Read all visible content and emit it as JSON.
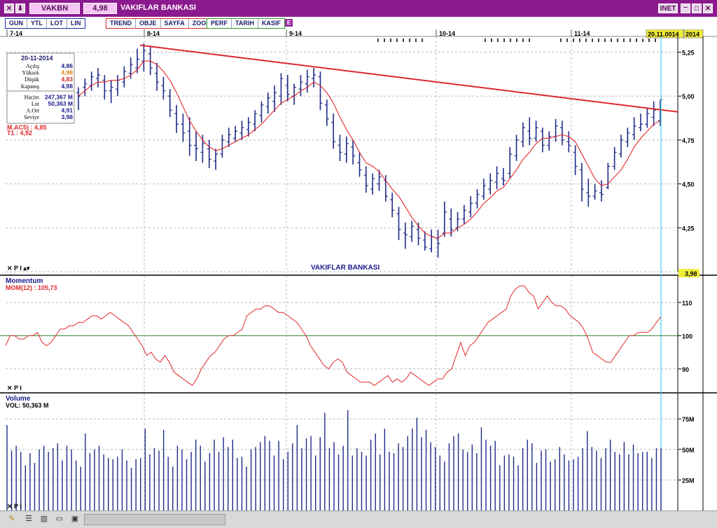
{
  "window": {
    "symbol": "VAKBN",
    "price": "4,98",
    "title": "VAKIFLAR BANKASI",
    "inet_label": "INET",
    "close_glyph": "✕",
    "down_glyph": "⬇",
    "min_glyph": "–",
    "max_glyph": "□",
    "x_glyph": "✕"
  },
  "toolbar": {
    "blue_group": [
      "GUN",
      "YTL",
      "LOT",
      "LIN"
    ],
    "red_group": [
      "TREND",
      "OBJE",
      "SAYFA",
      "ZOOM"
    ],
    "green_group": [
      "PERF",
      "TARIH",
      "KASIF"
    ],
    "e_label": "E"
  },
  "colors": {
    "title_bg": "#8b1a8f",
    "bar": "#1f2a8a",
    "ma": "#e0282a",
    "trend": "#e0282a",
    "momentum": "#e0282a",
    "baseline": "#2a8a2a",
    "volume": "#1f2a8a",
    "cursor": "#3fcfe8",
    "highlight": "#f0ee3a"
  },
  "chart_data": [
    {
      "type": "ohlc",
      "title": "VAKIFLAR BANKASI",
      "date_axis_labels": [
        "7-14",
        "8-14",
        "9-14",
        "10-14",
        "11-14"
      ],
      "cursor_date": "20.11.0014",
      "year_label": "2014",
      "y_ticks": [
        "5,25",
        "5,00",
        "4,75",
        "4,50",
        "4,25",
        "4,00"
      ],
      "ylim": [
        4.0,
        5.3
      ],
      "current_value_label": "3,98",
      "info_box": {
        "date": "20-11-2014",
        "rows": [
          {
            "label": "Açılış",
            "value": "4,86"
          },
          {
            "label": "Yüksek",
            "value": "4,98"
          },
          {
            "label": "Düşük",
            "value": "4,83"
          },
          {
            "label": "Kapanış",
            "value": "4,98"
          },
          {
            "label": "Hacim",
            "value": "247,367 M"
          },
          {
            "label": "Lot",
            "value": "50,363 M"
          },
          {
            "label": "A.Ort",
            "value": "4,91"
          },
          {
            "label": "Seviye",
            "value": "3,98"
          }
        ]
      },
      "legend": [
        {
          "label": "M.AC5)",
          "value": "4,85"
        },
        {
          "label": "T1",
          "value": "4,92"
        }
      ],
      "trendline": [
        [
          5.29,
          0.2
        ],
        [
          4.91,
          1.0
        ]
      ],
      "ohlc": [
        [
          5.02,
          5.05,
          4.92,
          5.0
        ],
        [
          5.05,
          5.1,
          5.0,
          5.07
        ],
        [
          5.06,
          5.14,
          5.03,
          5.11
        ],
        [
          5.1,
          5.16,
          5.05,
          5.12
        ],
        [
          5.09,
          5.12,
          4.98,
          5.03
        ],
        [
          5.03,
          5.09,
          4.96,
          5.05
        ],
        [
          5.04,
          5.12,
          5.0,
          5.09
        ],
        [
          5.08,
          5.17,
          5.05,
          5.14
        ],
        [
          5.13,
          5.22,
          5.1,
          5.18
        ],
        [
          5.16,
          5.27,
          5.13,
          5.21
        ],
        [
          5.2,
          5.3,
          5.14,
          5.26
        ],
        [
          5.24,
          5.28,
          5.12,
          5.16
        ],
        [
          5.13,
          5.19,
          5.03,
          5.08
        ],
        [
          5.06,
          5.11,
          4.98,
          5.03
        ],
        [
          5.0,
          5.04,
          4.88,
          4.92
        ],
        [
          4.9,
          4.95,
          4.79,
          4.84
        ],
        [
          4.84,
          4.9,
          4.74,
          4.79
        ],
        [
          4.8,
          4.88,
          4.66,
          4.72
        ],
        [
          4.72,
          4.8,
          4.63,
          4.7
        ],
        [
          4.68,
          4.78,
          4.62,
          4.73
        ],
        [
          4.7,
          4.75,
          4.59,
          4.64
        ],
        [
          4.63,
          4.7,
          4.58,
          4.67
        ],
        [
          4.67,
          4.78,
          4.65,
          4.75
        ],
        [
          4.74,
          4.82,
          4.71,
          4.78
        ],
        [
          4.76,
          4.83,
          4.74,
          4.8
        ],
        [
          4.79,
          4.86,
          4.75,
          4.82
        ],
        [
          4.81,
          4.88,
          4.77,
          4.85
        ],
        [
          4.84,
          4.92,
          4.8,
          4.9
        ],
        [
          4.89,
          4.97,
          4.85,
          4.95
        ],
        [
          4.94,
          5.02,
          4.9,
          4.99
        ],
        [
          4.97,
          5.06,
          4.91,
          5.02
        ],
        [
          5.0,
          5.13,
          4.95,
          5.1
        ],
        [
          5.06,
          5.12,
          4.97,
          5.01
        ],
        [
          5.0,
          5.07,
          4.95,
          5.05
        ],
        [
          5.04,
          5.12,
          5.0,
          5.08
        ],
        [
          5.07,
          5.15,
          5.02,
          5.11
        ],
        [
          5.1,
          5.16,
          5.05,
          5.12
        ],
        [
          5.11,
          5.14,
          4.92,
          4.96
        ],
        [
          4.95,
          4.98,
          4.83,
          4.87
        ],
        [
          4.85,
          4.9,
          4.7,
          4.74
        ],
        [
          4.72,
          4.78,
          4.63,
          4.68
        ],
        [
          4.67,
          4.77,
          4.62,
          4.73
        ],
        [
          4.71,
          4.75,
          4.61,
          4.66
        ],
        [
          4.62,
          4.68,
          4.54,
          4.58
        ],
        [
          4.55,
          4.6,
          4.45,
          4.49
        ],
        [
          4.47,
          4.56,
          4.44,
          4.53
        ],
        [
          4.5,
          4.58,
          4.46,
          4.54
        ],
        [
          4.52,
          4.55,
          4.4,
          4.43
        ],
        [
          4.41,
          4.45,
          4.31,
          4.35
        ],
        [
          4.33,
          4.37,
          4.18,
          4.24
        ],
        [
          4.22,
          4.28,
          4.13,
          4.21
        ],
        [
          4.2,
          4.29,
          4.17,
          4.26
        ],
        [
          4.24,
          4.28,
          4.15,
          4.19
        ],
        [
          4.18,
          4.23,
          4.12,
          4.14
        ],
        [
          4.13,
          4.24,
          4.11,
          4.2
        ],
        [
          4.19,
          4.24,
          4.08,
          4.16
        ],
        [
          4.22,
          4.4,
          4.2,
          4.34
        ],
        [
          4.3,
          4.36,
          4.2,
          4.24
        ],
        [
          4.25,
          4.34,
          4.23,
          4.3
        ],
        [
          4.3,
          4.38,
          4.27,
          4.35
        ],
        [
          4.34,
          4.43,
          4.31,
          4.39
        ],
        [
          4.39,
          4.47,
          4.36,
          4.44
        ],
        [
          4.43,
          4.53,
          4.41,
          4.49
        ],
        [
          4.47,
          4.56,
          4.44,
          4.52
        ],
        [
          4.51,
          4.6,
          4.47,
          4.56
        ],
        [
          4.53,
          4.59,
          4.49,
          4.52
        ],
        [
          4.56,
          4.71,
          4.53,
          4.67
        ],
        [
          4.66,
          4.78,
          4.63,
          4.75
        ],
        [
          4.74,
          4.85,
          4.71,
          4.82
        ],
        [
          4.8,
          4.88,
          4.72,
          4.76
        ],
        [
          4.76,
          4.86,
          4.74,
          4.82
        ],
        [
          4.8,
          4.82,
          4.68,
          4.72
        ],
        [
          4.72,
          4.8,
          4.69,
          4.77
        ],
        [
          4.77,
          4.87,
          4.74,
          4.83
        ],
        [
          4.82,
          4.86,
          4.72,
          4.75
        ],
        [
          4.74,
          4.8,
          4.68,
          4.72
        ],
        [
          4.68,
          4.72,
          4.55,
          4.6
        ],
        [
          4.58,
          4.62,
          4.4,
          4.47
        ],
        [
          4.45,
          4.53,
          4.37,
          4.43
        ],
        [
          4.43,
          4.5,
          4.41,
          4.46
        ],
        [
          4.45,
          4.52,
          4.4,
          4.44
        ],
        [
          4.48,
          4.62,
          4.47,
          4.6
        ],
        [
          4.6,
          4.71,
          4.58,
          4.68
        ],
        [
          4.67,
          4.78,
          4.65,
          4.75
        ],
        [
          4.74,
          4.82,
          4.71,
          4.79
        ],
        [
          4.78,
          4.88,
          4.75,
          4.83
        ],
        [
          4.82,
          4.9,
          4.8,
          4.84
        ],
        [
          4.84,
          4.93,
          4.82,
          4.9
        ],
        [
          4.88,
          4.97,
          4.83,
          4.92
        ],
        [
          4.86,
          4.98,
          4.83,
          4.98
        ]
      ],
      "moving_average": [
        5.0,
        5.03,
        5.06,
        5.08,
        5.08,
        5.09,
        5.09,
        5.1,
        5.12,
        5.15,
        5.2,
        5.2,
        5.18,
        5.14,
        5.09,
        5.02,
        4.94,
        4.86,
        4.8,
        4.75,
        4.71,
        4.69,
        4.7,
        4.72,
        4.74,
        4.76,
        4.78,
        4.81,
        4.84,
        4.88,
        4.92,
        4.96,
        4.98,
        5.0,
        5.03,
        5.05,
        5.08,
        5.06,
        5.02,
        4.96,
        4.88,
        4.81,
        4.75,
        4.68,
        4.62,
        4.6,
        4.57,
        4.52,
        4.47,
        4.43,
        4.37,
        4.31,
        4.26,
        4.22,
        4.2,
        4.19,
        4.22,
        4.22,
        4.25,
        4.27,
        4.3,
        4.34,
        4.39,
        4.42,
        4.46,
        4.48,
        4.53,
        4.58,
        4.64,
        4.68,
        4.73,
        4.76,
        4.76,
        4.77,
        4.78,
        4.77,
        4.74,
        4.67,
        4.6,
        4.53,
        4.49,
        4.5,
        4.54,
        4.58,
        4.64,
        4.71,
        4.76,
        4.8,
        4.84,
        4.86
      ]
    },
    {
      "type": "line",
      "title": "Momentum",
      "series": [
        {
          "name": "MOM(12)",
          "label": "MOM(12) : 105,73"
        }
      ],
      "y_ticks": [
        "110",
        "100",
        "90"
      ],
      "ylim": [
        83,
        118
      ],
      "baseline": 100,
      "values": [
        97,
        100,
        100,
        99,
        99,
        100,
        100,
        101,
        98,
        97,
        98,
        100,
        102,
        102,
        103,
        103,
        104,
        104,
        105,
        106,
        106,
        105,
        106,
        107,
        106,
        105,
        104,
        103,
        101,
        99,
        97,
        94,
        95,
        93,
        92,
        94,
        92,
        89,
        88,
        87,
        86,
        85,
        87,
        90,
        92,
        94,
        95,
        97,
        99,
        100,
        100,
        101,
        102,
        106,
        107,
        108,
        108,
        109,
        109,
        108,
        107,
        107,
        106,
        105,
        104,
        102,
        100,
        97,
        95,
        93,
        91,
        90,
        92,
        93,
        92,
        89,
        88,
        87,
        86,
        86,
        86,
        85,
        86,
        87,
        88,
        86,
        87,
        86,
        87,
        89,
        88,
        87,
        86,
        85,
        86,
        87,
        87,
        89,
        90,
        94,
        98,
        94,
        97,
        98,
        100,
        102,
        104,
        105,
        106,
        107,
        108,
        112,
        114,
        115,
        115,
        113,
        112,
        108,
        110,
        112,
        110,
        109,
        109,
        108,
        106,
        105,
        104,
        102,
        99,
        95,
        94,
        93,
        92,
        92,
        94,
        96,
        98,
        100,
        100,
        101,
        101,
        101,
        102,
        104,
        105.7
      ]
    },
    {
      "type": "bar",
      "title": "Volume",
      "series": [
        {
          "name": "VOL",
          "label": "VOL: 50,363 M"
        }
      ],
      "y_ticks": [
        "75M",
        "50M",
        "25M"
      ],
      "ylim": [
        0,
        90
      ],
      "values": [
        70,
        49,
        53,
        48,
        37,
        47,
        39,
        50,
        53,
        48,
        51,
        55,
        41,
        53,
        50,
        41,
        36,
        63,
        47,
        50,
        53,
        46,
        43,
        42,
        44,
        50,
        41,
        35,
        42,
        43,
        67,
        46,
        51,
        49,
        66,
        44,
        36,
        53,
        50,
        42,
        48,
        58,
        53,
        40,
        47,
        58,
        48,
        60,
        52,
        58,
        43,
        44,
        36,
        50,
        52,
        56,
        61,
        57,
        45,
        57,
        42,
        48,
        55,
        70,
        51,
        59,
        61,
        45,
        60,
        80,
        51,
        56,
        46,
        53,
        82,
        45,
        51,
        48,
        45,
        58,
        63,
        46,
        67,
        48,
        47,
        55,
        52,
        61,
        67,
        76,
        60,
        66,
        56,
        52,
        45,
        40,
        55,
        61,
        63,
        50,
        48,
        54,
        47,
        68,
        58,
        53,
        57,
        37,
        45,
        46,
        44,
        37,
        51,
        58,
        55,
        39,
        49,
        50,
        40,
        42,
        52,
        46,
        41,
        42,
        44,
        51,
        65,
        52,
        49,
        43,
        51,
        58,
        48,
        46,
        56,
        46,
        54,
        47,
        48,
        48,
        43,
        51,
        51
      ]
    }
  ]
}
